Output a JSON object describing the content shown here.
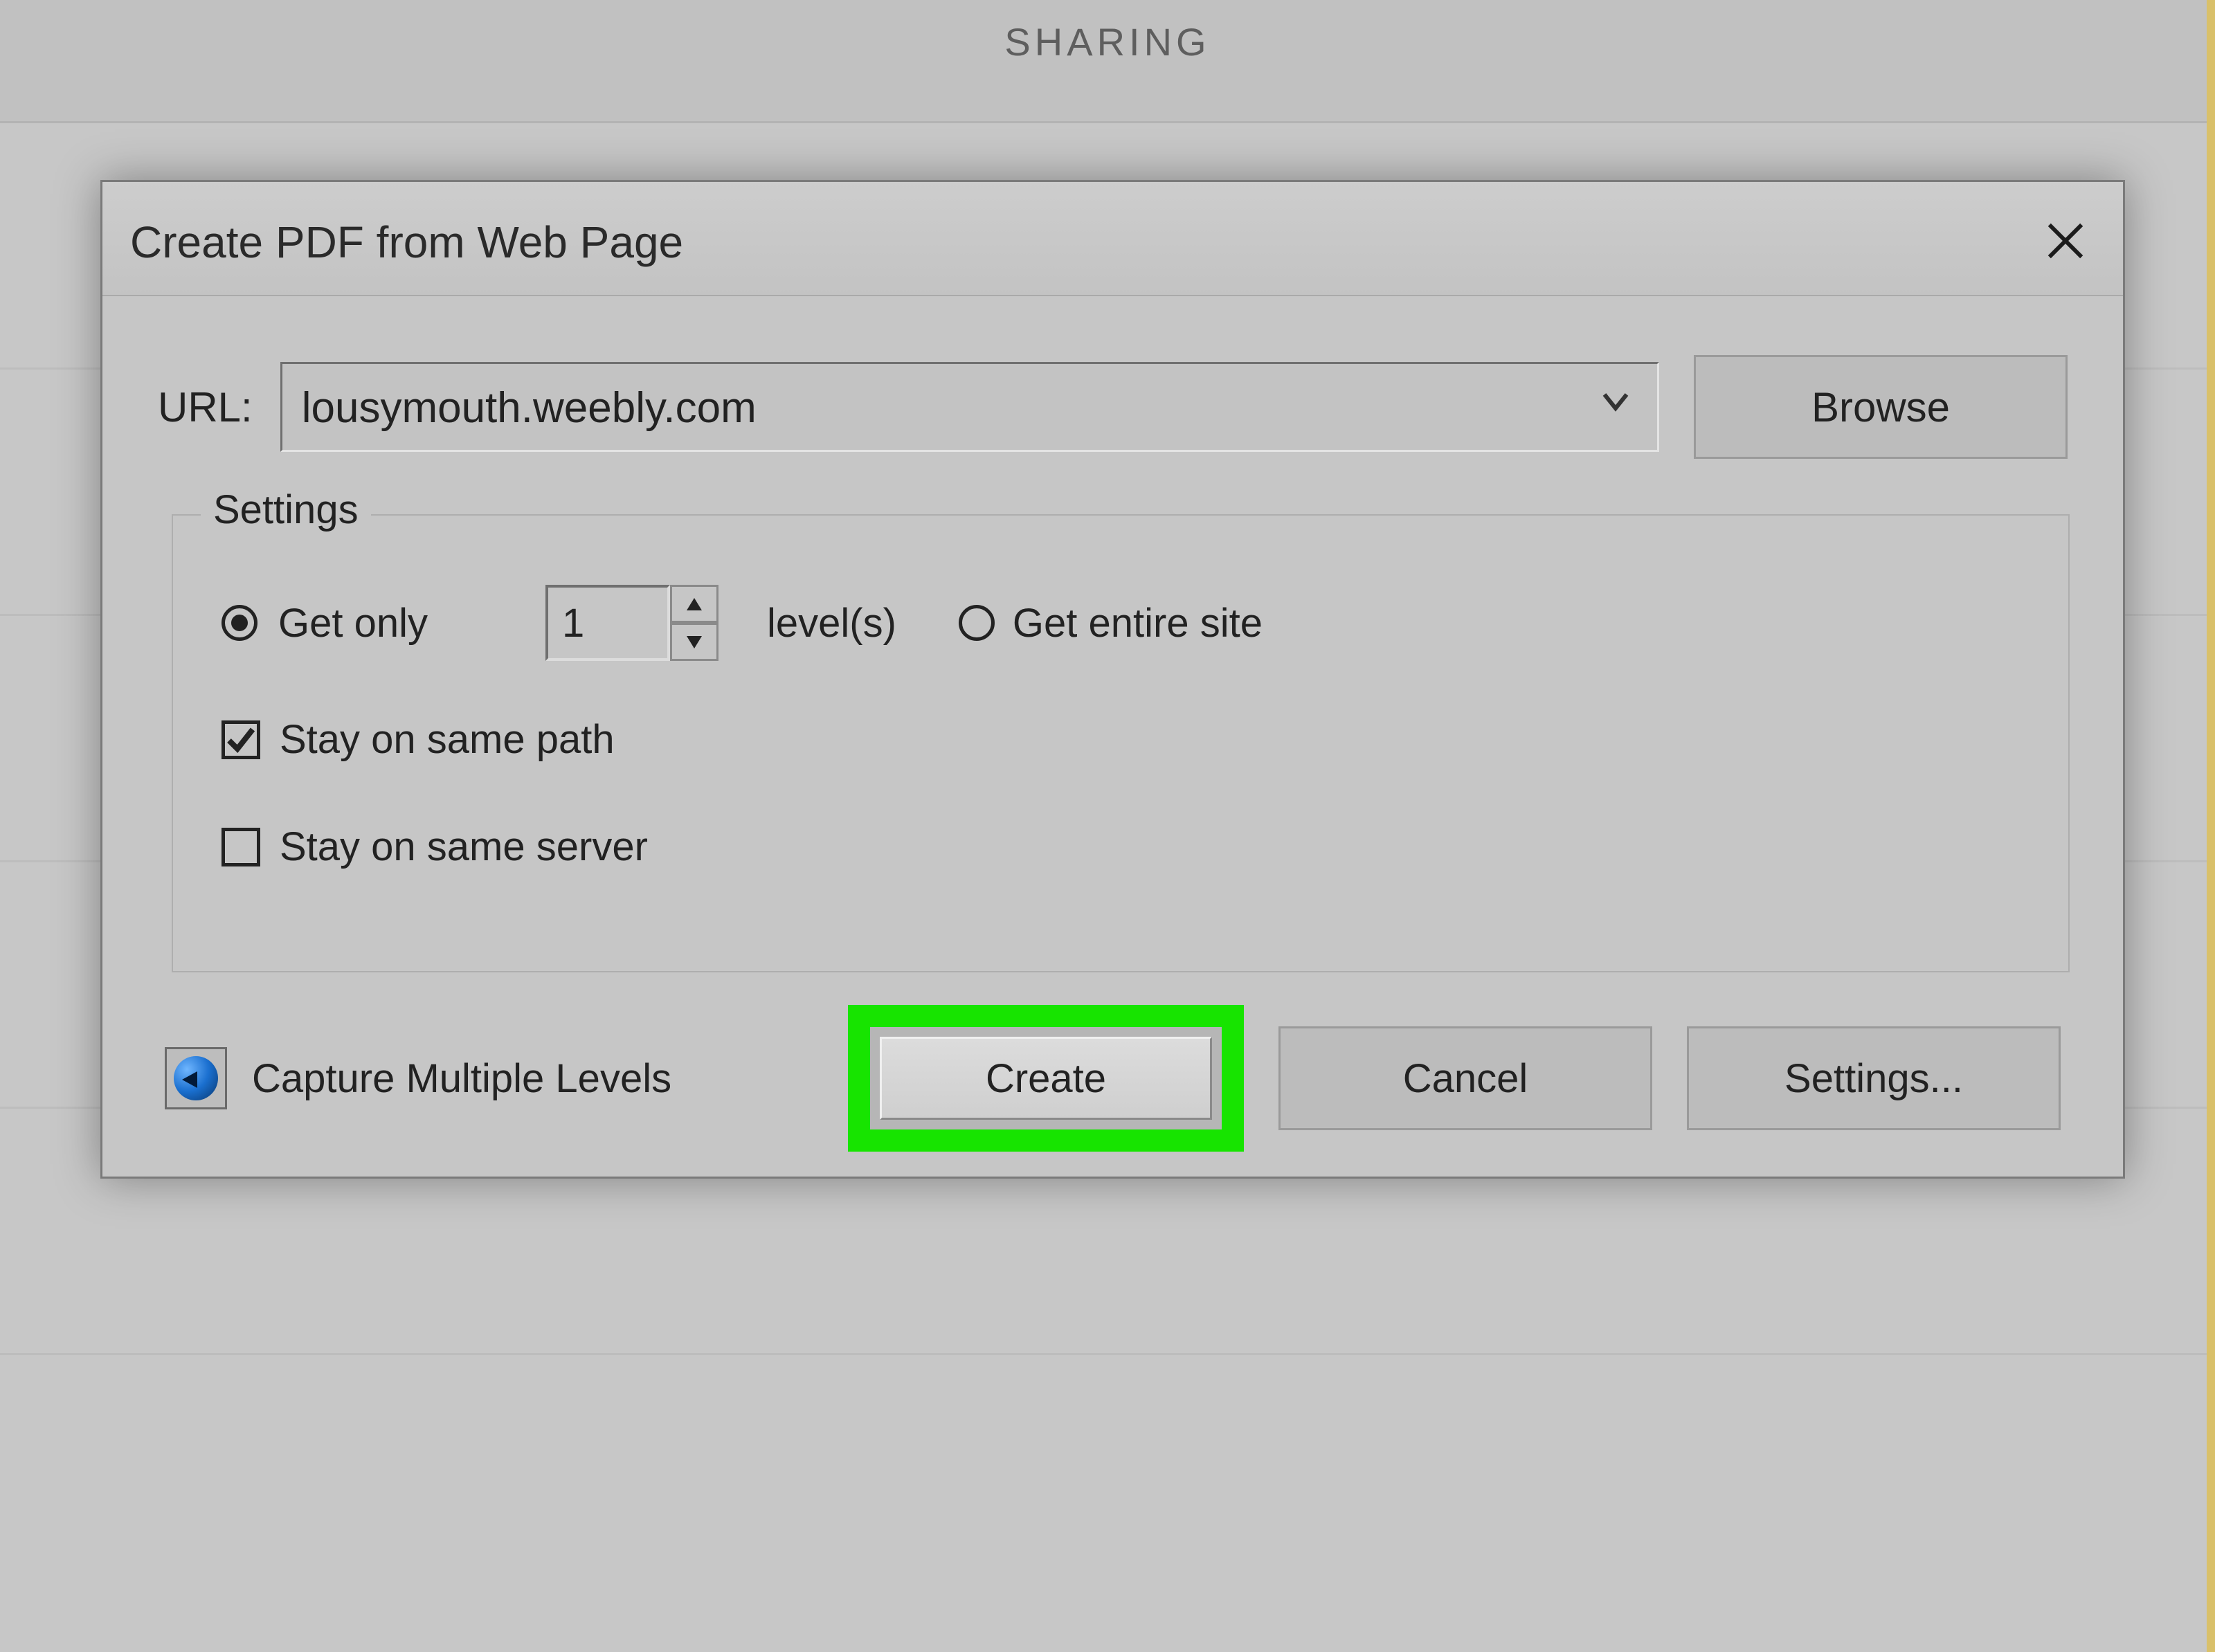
{
  "background": {
    "tab_label": "SHARING"
  },
  "dialog": {
    "title": "Create PDF from Web Page",
    "url": {
      "label": "URL:",
      "value": "lousymouth.weebly.com",
      "browse_label": "Browse"
    },
    "settings": {
      "legend": "Settings",
      "get_only_label": "Get only",
      "level_value": "1",
      "levels_suffix": "level(s)",
      "get_entire_label": "Get entire site",
      "get_only_selected": true,
      "stay_path_label": "Stay on same path",
      "stay_path_checked": true,
      "stay_server_label": "Stay on same server",
      "stay_server_checked": false
    },
    "footer": {
      "capture_label": "Capture Multiple Levels",
      "create_label": "Create",
      "cancel_label": "Cancel",
      "settings_label": "Settings..."
    }
  }
}
